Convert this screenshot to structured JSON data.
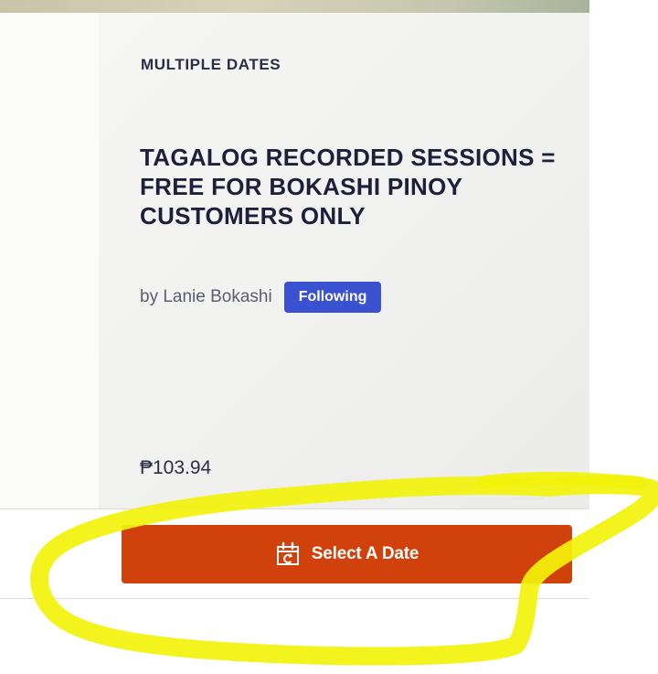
{
  "event": {
    "eyebrow": "MULTIPLE DATES",
    "title": "TAGALOG RECORDED SESSIONS = FREE FOR BOKASHI PINOY CUSTOMERS ONLY",
    "organizer": "by Lanie Bokashi",
    "follow_label": "Following",
    "price": "₱103.94"
  },
  "cta": {
    "label": "Select A Date",
    "icon": "calendar-icon",
    "color": "#d1410c"
  },
  "colors": {
    "follow_button": "#3b52d0",
    "highlight": "#f2f20a"
  }
}
